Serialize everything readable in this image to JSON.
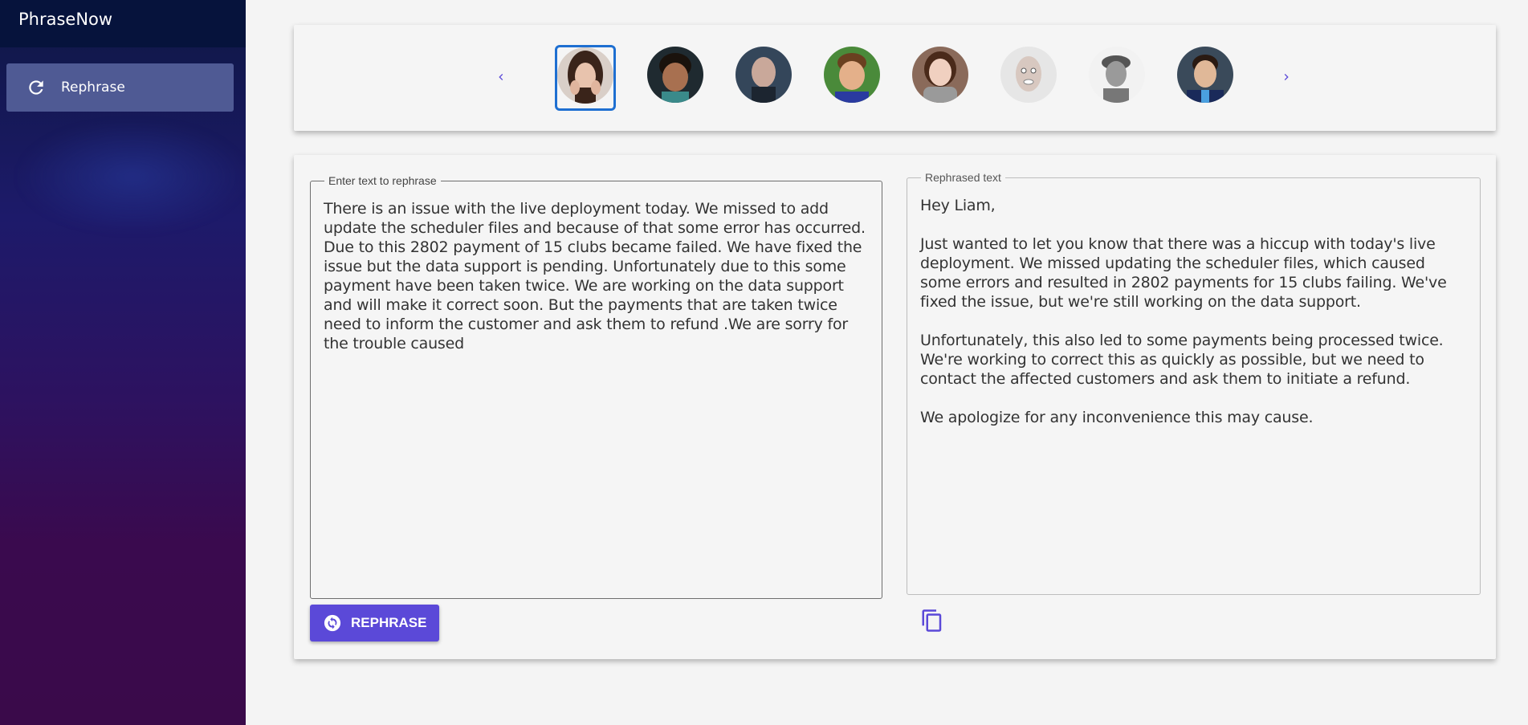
{
  "app": {
    "title": "PhraseNow"
  },
  "sidebar": {
    "items": [
      {
        "label": "Rephrase",
        "icon": "refresh-icon",
        "active": true
      }
    ]
  },
  "carousel": {
    "selected_index": 0,
    "avatars": [
      {
        "name": "avatar-woman-dark-hair"
      },
      {
        "name": "avatar-child"
      },
      {
        "name": "avatar-man-bald"
      },
      {
        "name": "avatar-boy-smiling"
      },
      {
        "name": "avatar-woman-scarf"
      },
      {
        "name": "avatar-man-funny-face"
      },
      {
        "name": "avatar-man-cap"
      },
      {
        "name": "avatar-man-suit"
      }
    ]
  },
  "input": {
    "label": "Enter text to rephrase",
    "value": "There is an issue with the live deployment today. We missed to add update the scheduler files and because of that some error has occurred. Due to this 2802 payment of 15 clubs became failed. We have fixed the issue but the data support is pending. Unfortunately due to this some payment have been taken twice. We are working on the data support and will make it correct soon. But the payments that are taken twice need to inform the customer and ask them to refund .We are sorry for the trouble caused"
  },
  "output": {
    "label": "Rephrased text",
    "value": "Hey Liam,\n\nJust wanted to let you know that there was a hiccup with today's live deployment. We missed updating the scheduler files, which caused some errors and resulted in 2802 payments for 15 clubs failing. We've fixed the issue, but we're still working on the data support.\n\nUnfortunately, this also led to some payments being processed twice. We're working to correct this as quickly as possible, but we need to contact the affected customers and ask them to initiate a refund.\n\nWe apologize for any inconvenience this may cause."
  },
  "actions": {
    "rephrase_label": "REPHRASE"
  },
  "colors": {
    "accent": "#5b49d8",
    "selected_border": "#1e6fd1",
    "sidebar_active": "#4f5a94"
  }
}
